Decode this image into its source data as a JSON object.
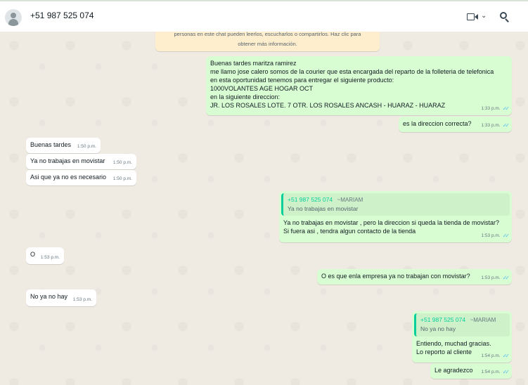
{
  "header": {
    "contact": "+51 987 525 074",
    "icons": [
      "avatar-icon",
      "video-camera-icon",
      "chevron-down-icon",
      "search-icon"
    ]
  },
  "notice": {
    "line1": "personas en este chat pueden leerlos, escucharlos o compartirlos. Haz clic para",
    "line2": "obtener más información."
  },
  "messages": {
    "m1": {
      "lines": [
        "Buenas tardes maritza ramirez",
        "me llamo jose calero somos de la courier que esta encargada del reparto de la folleteria de telefonica",
        "en esta oportunidad tenemos para entregar el siguiente producto:",
        "1000VOLANTES AGE HOGAR OCT",
        "en la siguiente direccion:",
        "JR. LOS ROSALES LOTE. 7 OTR. LOS ROSALES ANCASH - HUARAZ - HUARAZ"
      ],
      "time": "1:33 p.m."
    },
    "m2": {
      "text": "es la direccion correcta?",
      "time": "1:33 p.m."
    },
    "m3": {
      "text": "Buenas tardes",
      "time": "1:50 p.m."
    },
    "m4": {
      "text": "Ya no trabajas en movistar",
      "time": "1:50 p.m."
    },
    "m5": {
      "text": "Asi que ya no es necesario",
      "time": "1:50 p.m."
    },
    "m6": {
      "quote_name": "+51 987 525 074",
      "quote_alias": "~MARIAM",
      "quote_text": "Ya no trabajas en movistar",
      "lines": [
        "Ya no trabajas en movistar , pero la direccion si queda la tienda de movistar?",
        "Si fuera asi , tendra algun contacto de la tienda"
      ],
      "time": "1:53 p.m."
    },
    "m7": {
      "text": "O",
      "time": "1:53 p.m."
    },
    "m8": {
      "text": "O es que enla empresa ya no trabajan con movistar?",
      "time": "1:53 p.m."
    },
    "m9": {
      "text": "No ya no hay",
      "time": "1:53 p.m."
    },
    "m10": {
      "quote_name": "+51 987 525 074",
      "quote_alias": "~MARIAM",
      "quote_text": "No ya no hay",
      "lines": [
        "Entiendo, muchad gracias.",
        "Lo reporto al cliente"
      ],
      "time": "1:54 p.m."
    },
    "m11": {
      "text": "Le agradezco",
      "time": "1:54 p.m."
    }
  },
  "colors": {
    "incoming": "#ffffff",
    "outgoing": "#d9fdd3",
    "read_ticks": "#53bdeb",
    "quote_accent": "#06cf9c"
  }
}
